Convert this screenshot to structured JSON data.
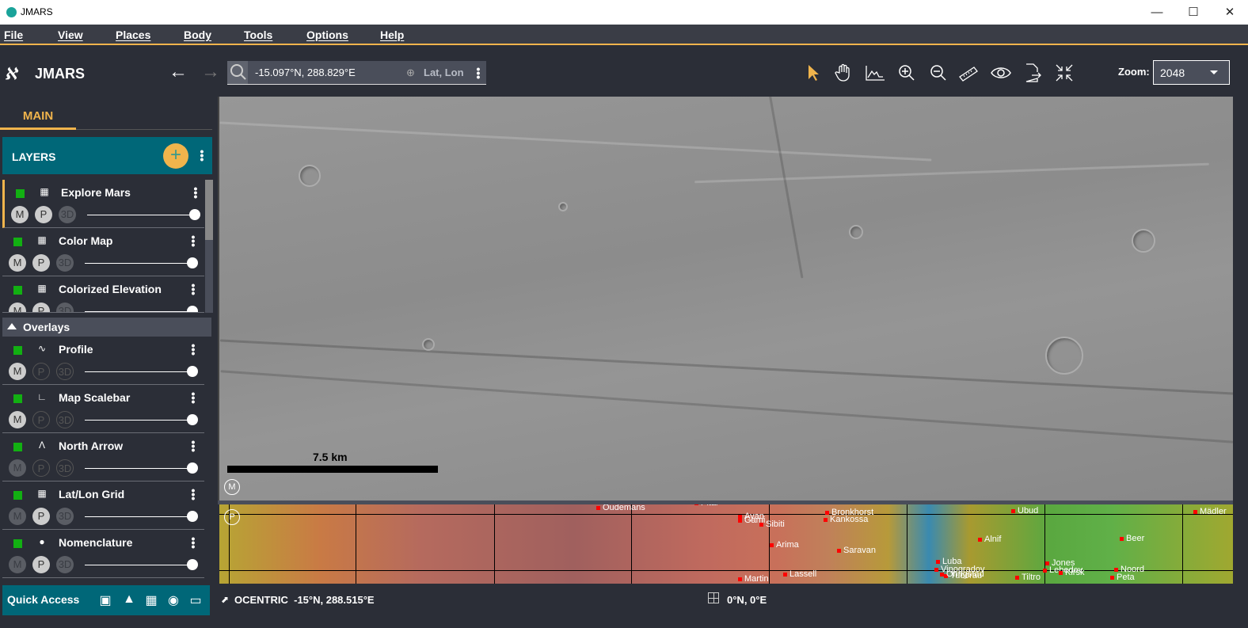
{
  "window": {
    "title": "JMARS",
    "controls": [
      "minimize",
      "maximize",
      "close"
    ]
  },
  "menu": [
    "File",
    "View",
    "Places",
    "Body",
    "Tools",
    "Options",
    "Help"
  ],
  "toolbar": {
    "brand": "JMARS",
    "search_value": "-15.097°N, 288.829°E",
    "coord_mode": "Lat, Lon",
    "zoom_label": "Zoom:",
    "zoom_value": "2048",
    "tools": [
      "select-arrow",
      "pan-hand",
      "profile",
      "zoom-in",
      "zoom-out",
      "ruler",
      "eye",
      "export",
      "collapse"
    ],
    "active_tool": "select-arrow"
  },
  "sidebar": {
    "tab": "MAIN",
    "layers_title": "LAYERS",
    "layers": [
      {
        "name": "Explore Mars",
        "M": "M",
        "P": "P",
        "D": "3D",
        "opacity": 100
      },
      {
        "name": "Color Map",
        "M": "M",
        "P": "P",
        "D": "3D",
        "opacity": 100
      },
      {
        "name": "Colorized Elevation",
        "M": "M",
        "P": "P",
        "D": "3D",
        "opacity": 100
      }
    ],
    "overlays_title": "Overlays",
    "overlays": [
      {
        "name": "Profile",
        "M": "M",
        "P": "P",
        "D": "3D",
        "opacity": 100
      },
      {
        "name": "Map Scalebar",
        "M": "M",
        "P": "P",
        "D": "3D",
        "opacity": 100
      },
      {
        "name": "North Arrow",
        "M": "M",
        "P": "P",
        "D": "3D",
        "opacity": 100
      },
      {
        "name": "Lat/Lon Grid",
        "M": "M",
        "P": "P",
        "D": "3D",
        "opacity": 100
      },
      {
        "name": "Nomenclature",
        "M": "M",
        "P": "P",
        "D": "3D",
        "opacity": 100
      }
    ],
    "quick_access": "Quick Access"
  },
  "map": {
    "scale_label": "7.5 km",
    "main_marker": "M",
    "panner_marker": "P"
  },
  "places": [
    "Oudemans",
    "Pital",
    "Ayan",
    "Gami",
    "Sibiti",
    "Bronkhorst",
    "Kankossa",
    "Arima",
    "Saravan",
    "Tucorau",
    "Martin",
    "Lassell",
    "Ubud",
    "Mädler",
    "Alnif",
    "Beer",
    "Luba",
    "Jones",
    "Noord",
    "Vinogradov",
    "Ohrigstad",
    "Lebedev",
    "Kirsk",
    "Peta",
    "Tiltro"
  ],
  "status": {
    "projection": "OCENTRIC",
    "cursor": "-15°N, 288.515°E",
    "center": "0°N, 0°E"
  },
  "colors": {
    "accent": "#f0b44c",
    "teal": "#006778",
    "visible": "#12b012"
  }
}
